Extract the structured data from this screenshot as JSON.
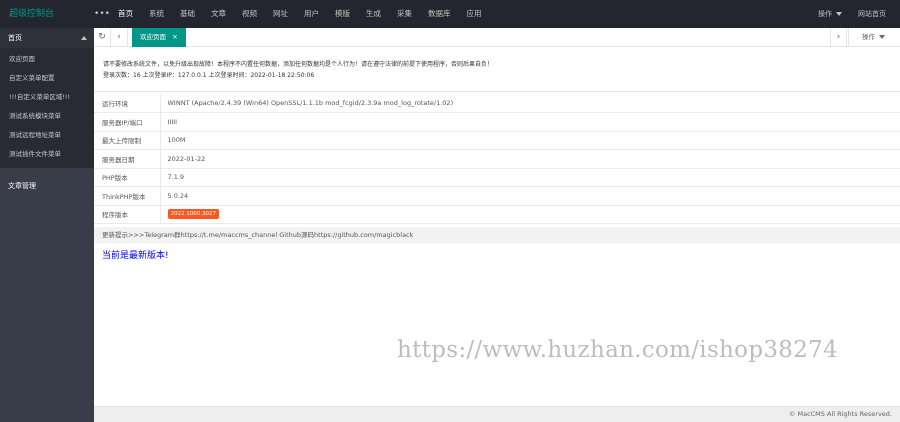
{
  "header": {
    "logo": "超级控制台",
    "fold_icon": "dots-icon",
    "nav": [
      "首页",
      "系统",
      "基础",
      "文章",
      "视频",
      "网址",
      "用户",
      "模版",
      "生成",
      "采集",
      "数据库",
      "应用"
    ],
    "active_nav": 0,
    "actions_label": "操作",
    "site_home_label": "网站首页"
  },
  "sidebar": {
    "group1": "首页",
    "items": [
      "欢迎页面",
      "自定义菜单配置",
      "!!!自定义菜单区域!!!",
      "测试系统模块菜单",
      "测试远程地址菜单",
      "测试插件文件菜单"
    ],
    "group2": "文章管理"
  },
  "tabs": {
    "active_label": "欢迎页面",
    "close_icon": "×",
    "refresh_icon": "refresh-icon",
    "prev_icon": "chevron-left-icon",
    "next_icon": "chevron-right-icon",
    "actions_label": "操作"
  },
  "notice": {
    "line1": "请不要修改系统文件，以免升级出现故障！本程序不内置任何数据，添加任何数据均是个人行为！请在遵守法律的前提下使用程序，否则后果自负！",
    "line2": "登录次数：16 上次登录IP：127.0.0.1 上次登录时间：2022-01-18 22:50:06"
  },
  "info": [
    {
      "k": "运行环境",
      "v": "WINNT (Apache/2.4.39 (Win64) OpenSSL/1.1.1b mod_fcgid/2.3.9a mod_log_rotate/1.02)"
    },
    {
      "k": "服务器IP/端口",
      "v": "IIIII"
    },
    {
      "k": "最大上传限制",
      "v": "100M"
    },
    {
      "k": "服务器日期",
      "v": "2022-01-22"
    },
    {
      "k": "PHP版本",
      "v": "7.1.9"
    },
    {
      "k": "ThinkPHP版本",
      "v": "5.0.24"
    },
    {
      "k": "程序版本",
      "v": "2022.1000.3027"
    }
  ],
  "update_line": "更新提示>>>Telegram群https://t.me/maccms_channel   Github源码https://github.com/magicblack",
  "latest": "当前是最新版本!",
  "watermark": "https://www.huzhan.com/ishop38274",
  "footer": "© MacCMS All Rights Reserved.",
  "colors": {
    "accent": "#009688",
    "topbar": "#23262e",
    "sidebar": "#393d49",
    "badge": "#ff5722"
  }
}
